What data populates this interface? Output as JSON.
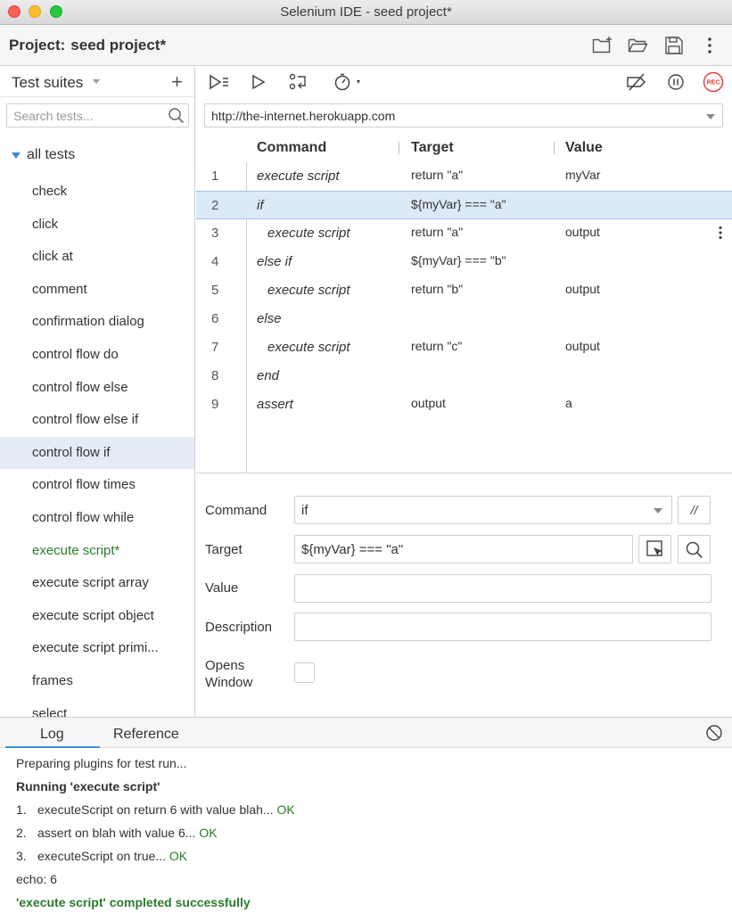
{
  "window": {
    "title": "Selenium IDE - seed project*"
  },
  "project": {
    "label": "Project:",
    "name": "seed project*"
  },
  "sidebar": {
    "dropdown_label": "Test suites",
    "search_placeholder": "Search tests...",
    "root_label": "all tests",
    "tests": [
      {
        "label": "check"
      },
      {
        "label": "click"
      },
      {
        "label": "click at"
      },
      {
        "label": "comment"
      },
      {
        "label": "confirmation dialog"
      },
      {
        "label": "control flow do"
      },
      {
        "label": "control flow else"
      },
      {
        "label": "control flow else if"
      },
      {
        "label": "control flow if"
      },
      {
        "label": "control flow times"
      },
      {
        "label": "control flow while"
      },
      {
        "label": "execute script*"
      },
      {
        "label": "execute script array"
      },
      {
        "label": "execute script object"
      },
      {
        "label": "execute script primi..."
      },
      {
        "label": "frames"
      },
      {
        "label": "select"
      }
    ],
    "selected_test": "control flow if",
    "modified_test": "execute script*"
  },
  "toolbar": {
    "rec_label": "REC"
  },
  "url": {
    "value": "http://the-internet.herokuapp.com"
  },
  "table": {
    "headers": {
      "command": "Command",
      "target": "Target",
      "value": "Value"
    },
    "rows": [
      {
        "num": "1",
        "command": "execute script",
        "target": "return \"a\"",
        "value": "myVar",
        "indent": 0
      },
      {
        "num": "2",
        "command": "if",
        "target": "${myVar} === \"a\"",
        "value": "",
        "indent": 0
      },
      {
        "num": "3",
        "command": "execute script",
        "target": "return \"a\"",
        "value": "output",
        "indent": 1
      },
      {
        "num": "4",
        "command": "else if",
        "target": "${myVar} === \"b\"",
        "value": "",
        "indent": 0
      },
      {
        "num": "5",
        "command": "execute script",
        "target": "return \"b\"",
        "value": "output",
        "indent": 1
      },
      {
        "num": "6",
        "command": "else",
        "target": "",
        "value": "",
        "indent": 0
      },
      {
        "num": "7",
        "command": "execute script",
        "target": "return \"c\"",
        "value": "output",
        "indent": 1
      },
      {
        "num": "8",
        "command": "end",
        "target": "",
        "value": "",
        "indent": 0
      },
      {
        "num": "9",
        "command": "assert",
        "target": "output",
        "value": "a",
        "indent": 0
      }
    ],
    "selected_row": "2"
  },
  "editor": {
    "command_label": "Command",
    "command_value": "if",
    "comment_button": "//",
    "target_label": "Target",
    "target_value": "${myVar} === \"a\"",
    "value_label": "Value",
    "value_value": "",
    "description_label": "Description",
    "description_value": "",
    "opens_window_label_1": "Opens",
    "opens_window_label_2": "Window"
  },
  "log": {
    "tabs": {
      "log": "Log",
      "reference": "Reference"
    },
    "lines": {
      "l1": "Preparing plugins for test run...",
      "l2": "Running 'execute script'",
      "l3_num": "1.",
      "l3_text": "executeScript on return 6 with value blah...",
      "l3_ok": "OK",
      "l4_num": "2.",
      "l4_text": "assert on blah with value 6...",
      "l4_ok": "OK",
      "l5_num": "3.",
      "l5_text": "executeScript on true...",
      "l5_ok": "OK",
      "l6": "echo: 6",
      "l7": "'execute script' completed successfully"
    }
  },
  "colors": {
    "accent": "#3e8ed0",
    "selection": "#e3ecf6",
    "success": "#2c7a2c",
    "record": "#e53935"
  }
}
